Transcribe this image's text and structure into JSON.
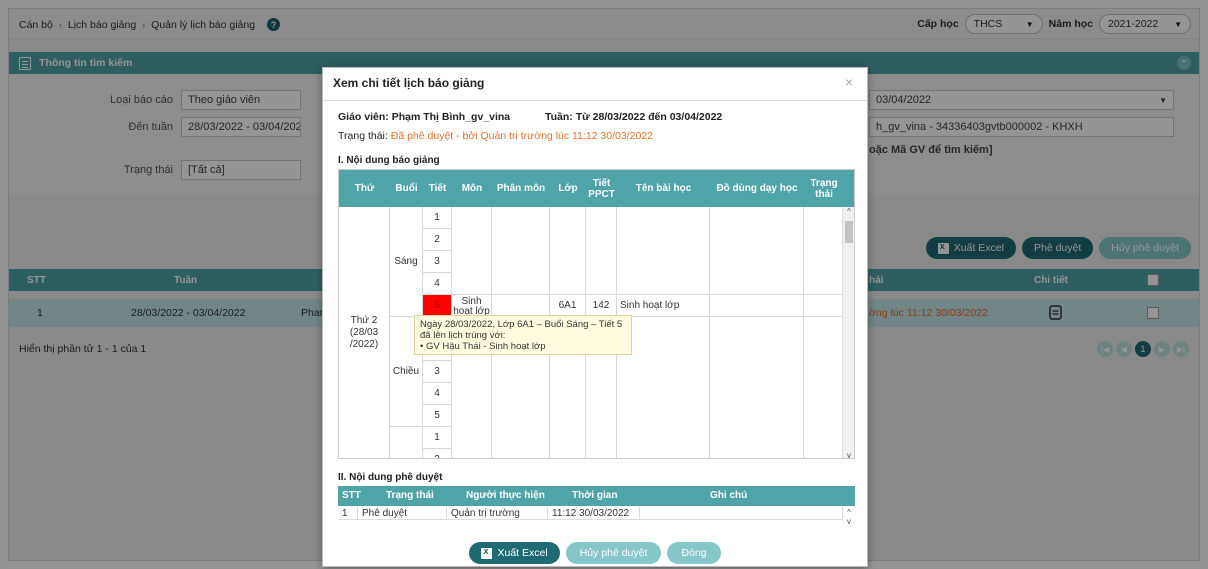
{
  "breadcrumb": {
    "items": [
      "Cán bộ",
      "Lịch báo giảng",
      "Quản lý lịch báo giảng"
    ],
    "sep": "›",
    "help": "?"
  },
  "topbar": {
    "level_label": "Cấp học",
    "level_value": "THCS",
    "year_label": "Năm học",
    "year_value": "2021-2022",
    "caret": "▼"
  },
  "panel": {
    "title": "Thông tin tìm kiếm",
    "collapse": "⌃"
  },
  "search": {
    "report_type_label": "Loại báo cáo",
    "report_type_value": "Theo giáo viên",
    "to_week_label": "Đến tuần",
    "to_week_value": "28/03/2022 - 03/04/2022",
    "status_label": "Trạng thái",
    "status_value": "[Tất cả]",
    "right_week_value": "03/04/2022",
    "right_teacher_value": "h_gv_vina - 34336403gvtb000002 - KHXH",
    "right_hint": "oặc Mã GV để tìm kiếm]"
  },
  "actions": {
    "export": "Xuất Excel",
    "approve": "Phê duyệt",
    "unapprove": "Hủy phê duyệt"
  },
  "grid": {
    "headers": {
      "stt": "STT",
      "tuan": "Tuần",
      "trangthai": "hái",
      "chitiet": "Chi tiết"
    },
    "row": {
      "stt": "1",
      "tuan": "28/03/2022 - 03/04/2022",
      "gv": "Phan",
      "status": "ờng lúc 11:12 30/03/2022"
    },
    "footer": "Hiển thị phần tử 1 - 1 của 1",
    "pager": {
      "first": "|◀",
      "prev": "◀",
      "current": "1",
      "next": "▶",
      "last": "▶|"
    }
  },
  "modal": {
    "title": "Xem chi tiết lịch báo giảng",
    "close": "×",
    "teacher_label": "Giáo viên:",
    "teacher_value": "Phạm Thị Bình_gv_vina",
    "week_label": "Tuần:",
    "week_value": "Từ 28/03/2022 đến 03/04/2022",
    "status_label": "Trạng thái:",
    "status_value": "Đã phê duyệt - bởi Quản trị trường lúc 11:12 30/03/2022",
    "section1": "I. Nội dung báo giảng",
    "columns": [
      "Thứ",
      "Buổi",
      "Tiết",
      "Môn",
      "Phân môn",
      "Lớp",
      "Tiết PPCT",
      "Tên bài học",
      "Đồ dùng dạy học",
      "Trạng thái"
    ],
    "day": "Thứ 2 (28/03 /2022)",
    "session_morning": "Sáng",
    "session_afternoon": "Chiều",
    "morning_periods": [
      "1",
      "2",
      "3",
      "4",
      "5"
    ],
    "afternoon_periods": [
      "1",
      "2",
      "3",
      "4",
      "5"
    ],
    "next_periods": [
      "1",
      "2"
    ],
    "highlight_row": {
      "subject": "Sinh hoạt lớp",
      "class": "6A1",
      "ppct": "142",
      "lesson": "Sinh hoạt lớp"
    },
    "tooltip": {
      "line1": "Ngày 28/03/2022, Lớp 6A1 – Buổi Sáng – Tiết 5",
      "line2": "đã lên lịch trùng với:",
      "line3": "• GV Hậu Thái - Sinh hoạt lớp"
    },
    "section2": "II. Nội dung phê duyệt",
    "approval_columns": [
      "STT",
      "Trạng thái",
      "Người thực hiện",
      "Thời gian",
      "Ghi chú"
    ],
    "approval_row": {
      "stt": "1",
      "status": "Phê duyệt",
      "by": "Quản trị trường",
      "time": "11:12 30/03/2022",
      "note": ""
    },
    "buttons": {
      "export": "Xuất Excel",
      "unapprove": "Hủy phê duyệt",
      "close": "Đóng"
    }
  },
  "scroll": {
    "up": "^",
    "down": "v"
  },
  "colors": {
    "teal": "#4fa4a7",
    "dark_teal": "#1f6a73",
    "light_teal": "#86c7c9",
    "orange": "#e8702a",
    "conflict": "#ff0000"
  }
}
